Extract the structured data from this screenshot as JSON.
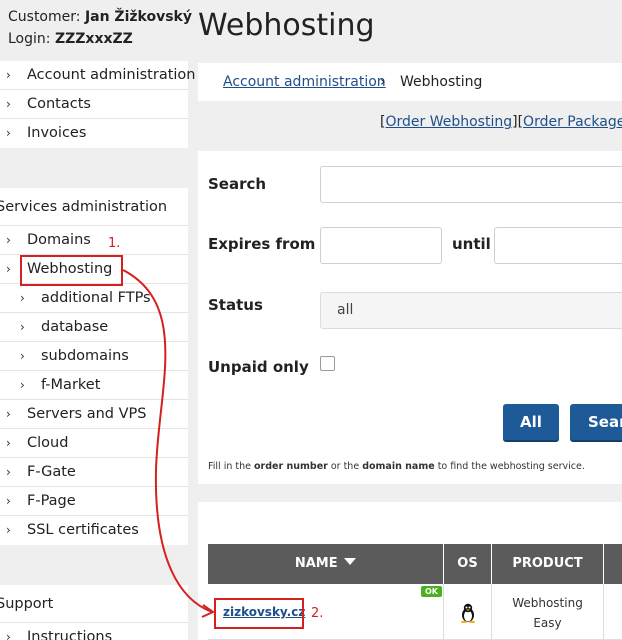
{
  "customer": {
    "customer_label": "Customer:",
    "customer_name": "Jan Žižkovský",
    "login_label": "Login:",
    "login_value": "ZZZxxxZZ"
  },
  "sidebar": {
    "account_items": [
      "Account administration",
      "Contacts",
      "Invoices"
    ],
    "services_title": "Services administration",
    "services_items": [
      {
        "label": "Domains",
        "level": 1
      },
      {
        "label": "Webhosting",
        "level": 1
      },
      {
        "label": "additional FTPs",
        "level": 2
      },
      {
        "label": "database",
        "level": 2
      },
      {
        "label": "subdomains",
        "level": 2
      },
      {
        "label": "f-Market",
        "level": 2
      },
      {
        "label": "Servers and VPS",
        "level": 1
      },
      {
        "label": "Cloud",
        "level": 1
      },
      {
        "label": "F-Gate",
        "level": 1
      },
      {
        "label": "F-Page",
        "level": 1
      },
      {
        "label": "SSL certificates",
        "level": 1
      }
    ],
    "support_title": "Support",
    "support_items": [
      "Instructions"
    ]
  },
  "header": {
    "title": "Webhosting",
    "breadcrumb_link": "Account administration",
    "breadcrumb_sep": "›",
    "breadcrumb_current": "Webhosting",
    "order_webhosting": "Order Webhosting",
    "order_package": "Order Package"
  },
  "search": {
    "search_label": "Search",
    "expires_label": "Expires from",
    "until_label": "until",
    "status_label": "Status",
    "status_value": "all",
    "unpaid_label": "Unpaid only",
    "btn_all": "All",
    "btn_search": "Search",
    "hint_1": "Fill in the ",
    "hint_b1": "order number",
    "hint_2": " or the ",
    "hint_b2": "domain name",
    "hint_3": " to find the webhosting service."
  },
  "table": {
    "columns": [
      "NAME",
      "OS",
      "PRODUCT"
    ],
    "sort_icon": "sort-down-icon",
    "rows": [
      {
        "name": "zizkovsky.cz",
        "status": "OK",
        "os_icon": "linux-tux-icon",
        "product_line1": "Webhosting",
        "product_line2": "Easy"
      }
    ]
  },
  "annotations": {
    "step1": "1.",
    "step2": "2.",
    "color": "#d62020"
  },
  "colors": {
    "link": "#1f4f8a",
    "button": "#1e5a98",
    "table_header": "#5b5b5b",
    "ok_badge": "#4caf22"
  }
}
